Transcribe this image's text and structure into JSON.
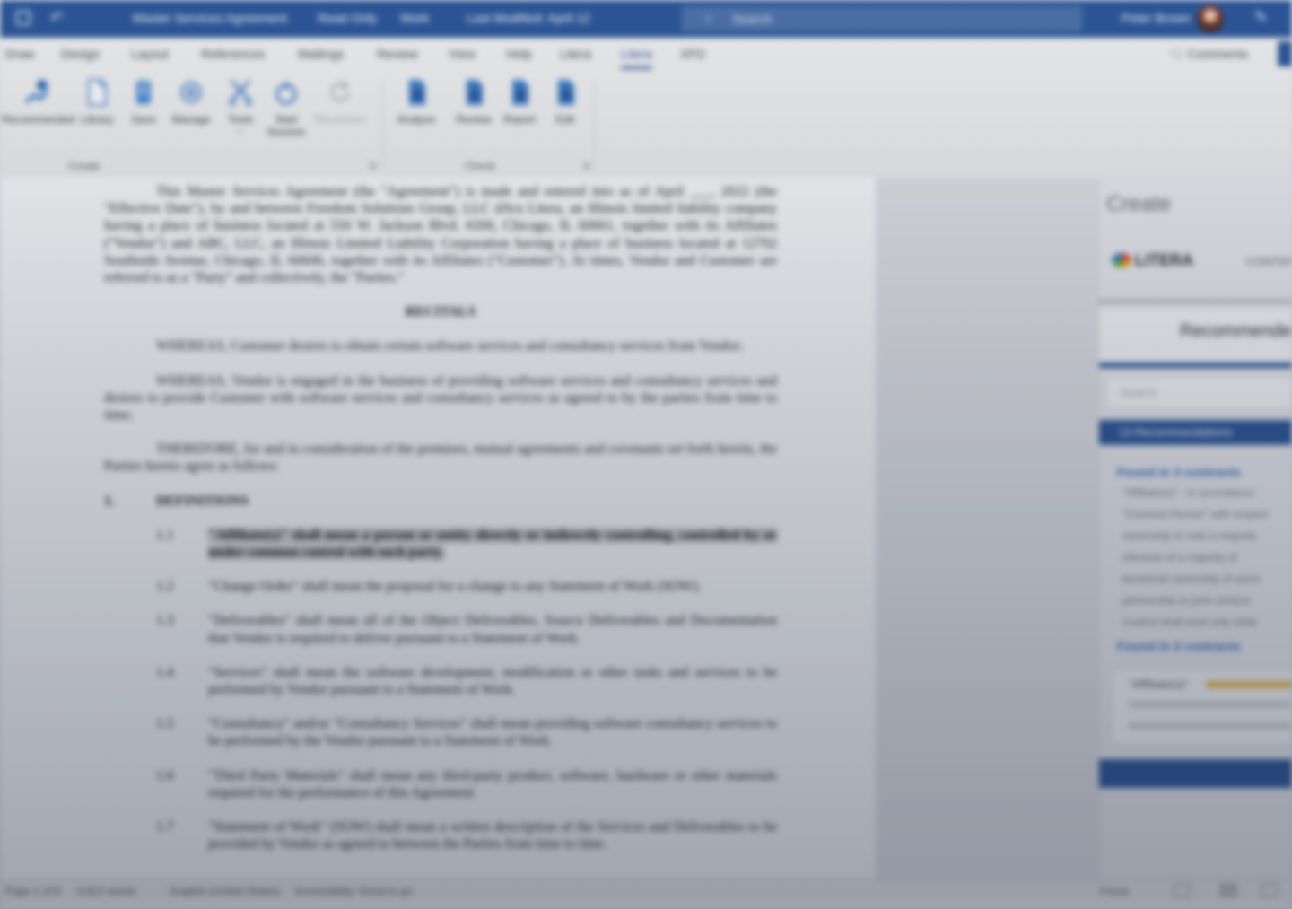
{
  "titlebar": {
    "doc_title": "Master Services Agreement",
    "mode": "Read Only",
    "sensitivity": "Work",
    "saved_status": "Last Modified: April 12",
    "search_placeholder": "Search",
    "user_name": "Peter Brown"
  },
  "tabs": [
    "Draw",
    "Design",
    "Layout",
    "References",
    "Mailings",
    "Review",
    "View",
    "Help",
    "Litera",
    "Litera",
    "XFD"
  ],
  "active_tab_index": 9,
  "comments_label": "Comments",
  "ribbon": {
    "buttons": [
      {
        "label": "Recommended",
        "icon": "recommended-icon"
      },
      {
        "label": "Library",
        "icon": "library-icon"
      },
      {
        "label": "Save",
        "icon": "save-icon"
      },
      {
        "label": "Manage",
        "icon": "manage-icon"
      },
      {
        "label": "Tools",
        "icon": "scissors-icon"
      },
      {
        "label": "Start",
        "sub": "Session",
        "icon": "start-icon"
      },
      {
        "label": "Reconnect",
        "icon": "refresh-icon"
      },
      {
        "label": "Analyze",
        "icon": "analyze-icon"
      },
      {
        "label": "Review",
        "icon": "review-icon"
      },
      {
        "label": "Report",
        "icon": "report-icon"
      },
      {
        "label": "Edit",
        "icon": "edit-icon"
      }
    ],
    "groups": [
      "Create",
      "Check"
    ],
    "accent": "#2b579a"
  },
  "document": {
    "intro": "This Master Services Agreement (the \"Agreement\") is made and entered into as of April ___, 2022 (the \"Effective Date\"), by and between Freedom Solutions Group, LLC d/b/a Litera, an Illinois limited liability company having a place of business located at 550 W. Jackson Blvd. #200, Chicago, IL 60661, together with its Affiliates (\"Vendor\") and ABC, LLC, an Illinois Limited Liability Corporation having a place of business located at 12702 Southside Avenue, Chicago, IL 60606, together with its Affiliates (\"Customer\"). At times, Vendor and Customer are referred to as a \"Party\" and collectively, the \"Parties.\"",
    "recitals_heading": "RECITALS",
    "recital_1": "WHEREAS, Customer desires to obtain certain software services and consultancy services from Vendor;",
    "recital_2": "WHEREAS, Vendor is engaged in the business of providing software services and consultancy services and desires to provide Customer with software services and consultancy services as agreed to by the parties from time to time;",
    "recital_3": "THEREFORE, for and in consideration of the premises, mutual agreements and covenants set forth herein, the Parties hereto agree as follows:",
    "section_num": "1.",
    "section_title": "DEFINITIONS",
    "items": [
      {
        "num": "1.1",
        "text": "\"Affiliate(s)\" shall mean a person or entity directly or indirectly controlling, controlled by or under common control with such party."
      },
      {
        "num": "1.2",
        "text": "\"Change Order\" shall mean the proposal for a change to any Statement of Work (SOW)."
      },
      {
        "num": "1.3",
        "text": "\"Deliverables\" shall mean all of the Object Deliverables, Source Deliverables and Documentation that Vendor is required to deliver pursuant to a Statement of Work."
      },
      {
        "num": "1.4",
        "text": "\"Services\" shall mean the software development, modification or other tasks and services to be performed by Vendor pursuant to a Statement of Work."
      },
      {
        "num": "1.5",
        "text": "\"Consultancy\" and/or \"Consultancy Services\" shall mean providing software consultancy services to be performed by the Vendor pursuant to a Statement of Work."
      },
      {
        "num": "1.6",
        "text": "\"Third Party Materials\" shall mean any third-party product, software, hardware or other materials required for the performance of this Agreement."
      },
      {
        "num": "1.7",
        "text": "\"Statement of Work\" (SOW) shall mean a written description of the Services and Deliverables to be provided by Vendor as agreed to between the Parties from time to time."
      }
    ]
  },
  "panel": {
    "header": "Create",
    "brand": "LITERA",
    "brand_tab": "CONTENT",
    "title": "Recommended",
    "search_placeholder": "Search",
    "results_label": "13 Recommendations",
    "found_1": "Found in 3 contracts",
    "lines_1": [
      "\"Affiliate(s)\" - in accordance",
      "\"Covered Person\" with respect",
      "ownership to vote a majority",
      "interests of a majority of",
      "beneficial ownership of stock",
      "partnership or joint venture",
      "Control shall exist only while"
    ],
    "found_2": "Found in 2 contracts",
    "snippet_label": "\"Affiliate(s)\""
  },
  "statusbar": {
    "page": "Page 1 of 8",
    "words": "4,812 words",
    "language": "English (United States)",
    "accessibility": "Accessibility: Good to go",
    "focus": "Focus"
  }
}
